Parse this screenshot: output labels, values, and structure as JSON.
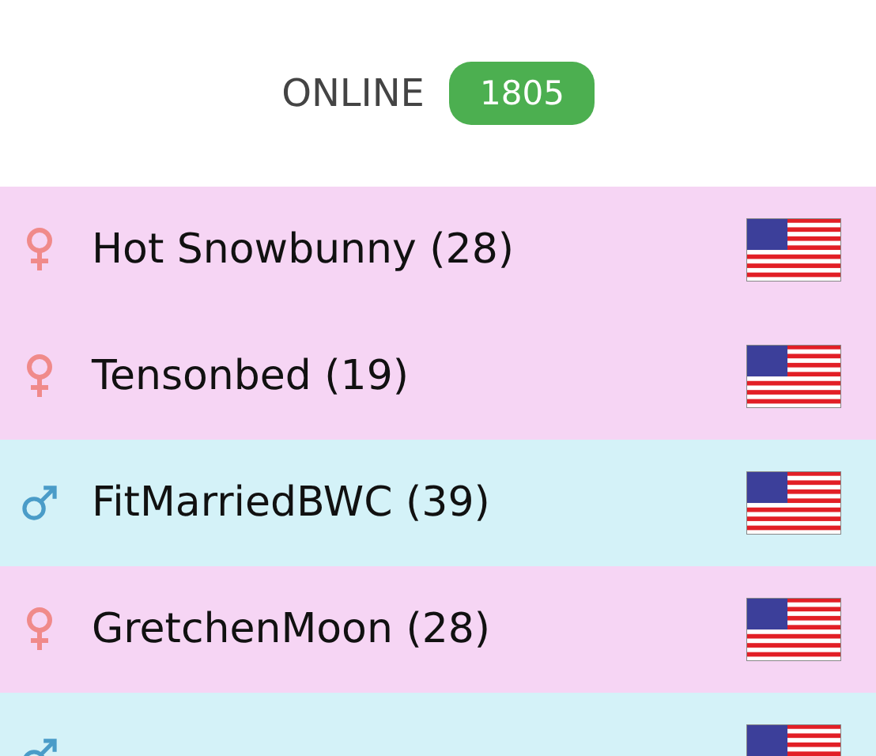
{
  "header": {
    "label": "ONLINE",
    "count": "1805"
  },
  "users": [
    {
      "name": "Hot Snowbunny (28)",
      "kind": "female"
    },
    {
      "name": "Tensonbed (19)",
      "kind": "female"
    },
    {
      "name": "FitMarriedBWC (39)",
      "kind": "male"
    },
    {
      "name": "GretchenMoon (28)",
      "kind": "female"
    },
    {
      "kind": "male"
    }
  ]
}
